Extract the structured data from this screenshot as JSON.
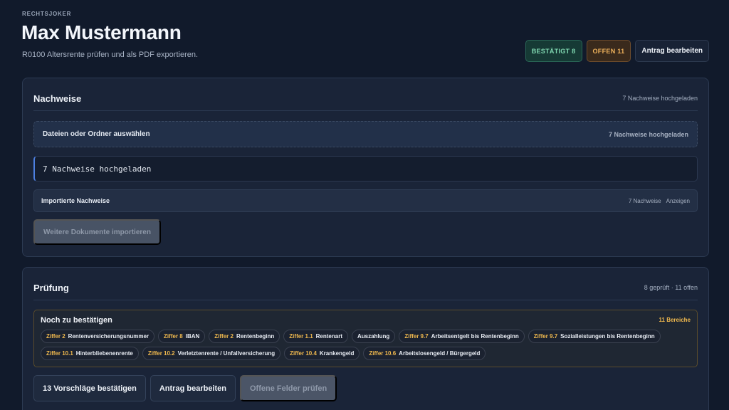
{
  "brand": "RECHTSJOKER",
  "header": {
    "name": "Max Mustermann",
    "subtitle": "R0100 Altersrente prüfen und als PDF exportieren.",
    "confirmed_chip": "BESTÄTIGT 8",
    "open_chip": "OFFEN 11",
    "edit_button": "Antrag bearbeiten",
    "colors": {
      "confirmed": "#7fd7b0",
      "open": "#f0b35c"
    }
  },
  "evidence": {
    "title": "Nachweise",
    "meta": "7 Nachweise hochgeladen",
    "dropzone_label": "Dateien oder Ordner auswählen",
    "dropzone_meta": "7 Nachweise hochgeladen",
    "status_text": "7 Nachweise hochgeladen",
    "imported_title": "Importierte Nachweise",
    "imported_count": "7 Nachweise",
    "imported_show": "Anzeigen",
    "import_more_button": "Weitere Dokumente importieren"
  },
  "review": {
    "title": "Prüfung",
    "meta": "8 geprüft · 11 offen",
    "pending_title": "Noch zu bestätigen",
    "pending_count": "11 Bereiche",
    "tags": [
      {
        "code": "Ziffer 2",
        "label": "Rentenversicherungsnummer"
      },
      {
        "code": "Ziffer 8",
        "label": "IBAN"
      },
      {
        "code": "Ziffer 2",
        "label": "Rentenbeginn"
      },
      {
        "code": "Ziffer 1.1",
        "label": "Rentenart"
      },
      {
        "code": "",
        "label": "Auszahlung"
      },
      {
        "code": "Ziffer 9.7",
        "label": "Arbeitsentgelt bis Rentenbeginn"
      },
      {
        "code": "Ziffer 9.7",
        "label": "Sozialleistungen bis Rentenbeginn"
      },
      {
        "code": "Ziffer 10.1",
        "label": "Hinterbliebenenrente"
      },
      {
        "code": "Ziffer 10.2",
        "label": "Verletztenrente / Unfallversicherung"
      },
      {
        "code": "Ziffer 10.4",
        "label": "Krankengeld"
      },
      {
        "code": "Ziffer 10.6",
        "label": "Arbeitslosengeld / Bürgergeld"
      }
    ],
    "confirm_button": "13 Vorschläge bestätigen",
    "edit_button": "Antrag bearbeiten",
    "check_button": "Offene Felder prüfen"
  }
}
